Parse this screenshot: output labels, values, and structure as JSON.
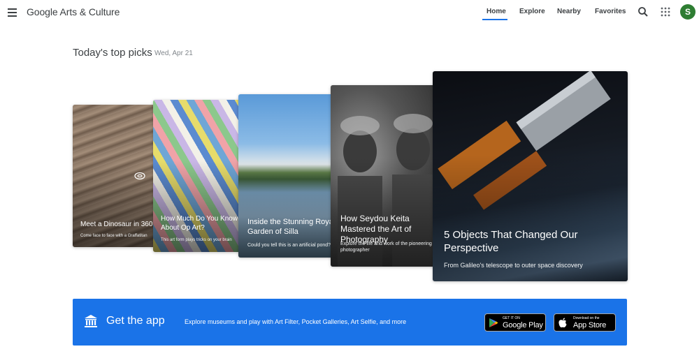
{
  "header": {
    "brand": "Google Arts & Culture",
    "nav": [
      {
        "label": "Home",
        "active": true
      },
      {
        "label": "Explore"
      },
      {
        "label": "Nearby"
      },
      {
        "label": "Favorites"
      }
    ],
    "avatar_letter": "S",
    "icons": [
      "menu-icon",
      "search-icon",
      "apps-grid-icon"
    ]
  },
  "section": {
    "title": "Today's top picks",
    "date": "Wed, Apr 21"
  },
  "cards": [
    {
      "title": "Meet a Dinosaur in 360°",
      "desc": "Come face to face with a Graffatitan"
    },
    {
      "title": "How Much Do You Know About Op Art?",
      "desc": "This art form plays tricks on your brain"
    },
    {
      "title": "Inside the Stunning Royal Garden of Silla",
      "desc": "Could you tell this is an artificial pond?"
    },
    {
      "title": "How Seydou Keita Mastered the Art of Photography",
      "desc": "Explore the life and work of the pioneering photographer"
    },
    {
      "title": "5 Objects That Changed Our Perspective",
      "desc": "From Galileo's telescope to outer space discovery"
    }
  ],
  "banner": {
    "title": "Get the app",
    "desc": "Explore museums and play with Art Filter, Pocket Galleries, Art Selfie, and more",
    "google_play": {
      "small": "GET IT ON",
      "big": "Google Play"
    },
    "app_store": {
      "small": "Download on the",
      "big": "App Store"
    }
  },
  "colors": {
    "accent": "#1a73e8",
    "avatar": "#2e7d32"
  }
}
